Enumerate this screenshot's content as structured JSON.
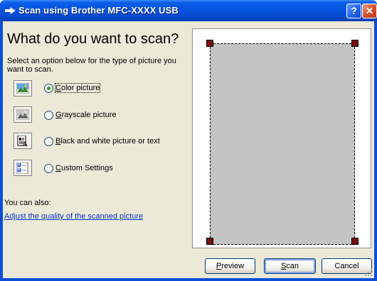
{
  "window": {
    "title": "Scan using Brother MFC-XXXX  USB",
    "title_icon": "scanner-icon",
    "help_label": "?",
    "close_label": "✕"
  },
  "main": {
    "heading": "What do you want to scan?",
    "instructions": "Select an option below for the type of picture you want to scan.",
    "options": [
      {
        "label": "Color picture",
        "mnemonic": "C",
        "rest": "olor picture",
        "icon": "color-picture-icon",
        "selected": true
      },
      {
        "label": "Grayscale picture",
        "mnemonic": "G",
        "rest": "rayscale picture",
        "icon": "grayscale-picture-icon",
        "selected": false
      },
      {
        "label": "Black and white picture or text",
        "mnemonic": "B",
        "rest": "lack and white picture or text",
        "icon": "black-white-text-icon",
        "selected": false
      },
      {
        "label": "Custom Settings",
        "mnemonic": "C",
        "rest": "ustom Settings",
        "icon": "custom-settings-icon",
        "selected": false
      }
    ],
    "also_label": "You can also:",
    "adjust_link": "Adjust the quality of the scanned picture"
  },
  "buttons": {
    "preview": {
      "label": "Preview",
      "mnemonic": "P",
      "rest": "review"
    },
    "scan": {
      "label": "Scan",
      "mnemonic": "S",
      "rest": "can"
    },
    "cancel": {
      "label": "Cancel"
    }
  },
  "colors": {
    "title_bar": "#0553e0",
    "dialog_bg": "#ece9d8",
    "preview_area": "#c4c4c4",
    "crop_handle": "#7b0f0f",
    "link": "#0033cc"
  }
}
